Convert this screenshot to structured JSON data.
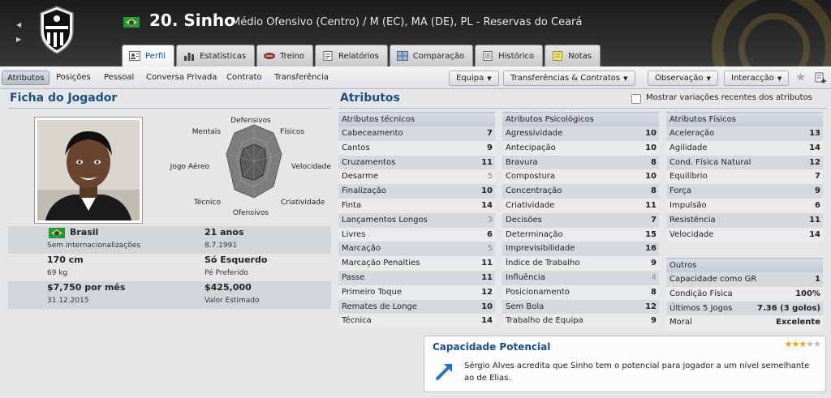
{
  "header": {
    "squad_number_name": "20. Sinho",
    "position_text": "Médio Ofensivo (Centro) / M (EC), MA (DE), PL - Reservas do Ceará",
    "club_crest_text": "CEARÁ"
  },
  "main_tabs": [
    {
      "label": "Perfil",
      "icon": "profile-icon"
    },
    {
      "label": "Estatísticas",
      "icon": "stats-icon"
    },
    {
      "label": "Treino",
      "icon": "training-icon"
    },
    {
      "label": "Relatórios",
      "icon": "report-icon"
    },
    {
      "label": "Comparação",
      "icon": "compare-icon"
    },
    {
      "label": "Histórico",
      "icon": "history-icon"
    },
    {
      "label": "Notas",
      "icon": "notes-icon"
    }
  ],
  "sub_nav": [
    "Atributos",
    "Posições",
    "Pessoal",
    "Conversa Privada",
    "Contrato",
    "Transferência"
  ],
  "dropdowns": [
    "Equipa",
    "Transferências & Contratos",
    "Observação",
    "Interacção"
  ],
  "player_card": {
    "title": "Ficha do Jogador",
    "nationality": "Brasil",
    "caps": "Sem internacionalizações",
    "age": "21 anos",
    "birth_date": "8.7.1991",
    "height": "170 cm",
    "weight": "69 kg",
    "foot": "Só Esquerdo",
    "foot_label": "Pé Preferido",
    "wage": "$7,750 por mês",
    "contract_end": "31.12.2015",
    "value": "$425,000",
    "value_label": "Valor Estimado"
  },
  "radar": {
    "labels": {
      "top": "Defensivos",
      "top_right": "Físicos",
      "right": "Velocidade",
      "bottom_right": "Criatividade",
      "bottom": "Ofensivos",
      "bottom_left": "Técnico",
      "left": "Jogo Aéreo",
      "top_left": "Mentais"
    }
  },
  "attributes": {
    "title": "Atributos",
    "show_changes_label": "Mostrar variações recentes dos atributos",
    "technical": {
      "header": "Atributos técnicos",
      "rows": [
        {
          "name": "Cabeceamento",
          "value": "7"
        },
        {
          "name": "Cantos",
          "value": "9"
        },
        {
          "name": "Cruzamentos",
          "value": "11"
        },
        {
          "name": "Desarme",
          "value": "5"
        },
        {
          "name": "Finalização",
          "value": "10"
        },
        {
          "name": "Finta",
          "value": "14"
        },
        {
          "name": "Lançamentos Longos",
          "value": "3"
        },
        {
          "name": "Livres",
          "value": "6"
        },
        {
          "name": "Marcação",
          "value": "5"
        },
        {
          "name": "Marcação Penalties",
          "value": "11"
        },
        {
          "name": "Passe",
          "value": "11"
        },
        {
          "name": "Primeiro Toque",
          "value": "12"
        },
        {
          "name": "Remates de Longe",
          "value": "10"
        },
        {
          "name": "Técnica",
          "value": "14"
        }
      ]
    },
    "mental": {
      "header": "Atributos Psicológicos",
      "rows": [
        {
          "name": "Agressividade",
          "value": "10"
        },
        {
          "name": "Antecipação",
          "value": "10"
        },
        {
          "name": "Bravura",
          "value": "8"
        },
        {
          "name": "Compostura",
          "value": "10"
        },
        {
          "name": "Concentração",
          "value": "8"
        },
        {
          "name": "Criatividade",
          "value": "11"
        },
        {
          "name": "Decisões",
          "value": "7"
        },
        {
          "name": "Determinação",
          "value": "15"
        },
        {
          "name": "Imprevisibilidade",
          "value": "16"
        },
        {
          "name": "Índice de Trabalho",
          "value": "9"
        },
        {
          "name": "Influência",
          "value": "4"
        },
        {
          "name": "Posicionamento",
          "value": "8"
        },
        {
          "name": "Sem Bola",
          "value": "12"
        },
        {
          "name": "Trabalho de Equipa",
          "value": "9"
        }
      ]
    },
    "physical": {
      "header": "Atributos Físicos",
      "rows": [
        {
          "name": "Aceleração",
          "value": "13"
        },
        {
          "name": "Agilidade",
          "value": "14"
        },
        {
          "name": "Cond. Física Natural",
          "value": "12"
        },
        {
          "name": "Equilíbrio",
          "value": "7"
        },
        {
          "name": "Força",
          "value": "9"
        },
        {
          "name": "Impulsão",
          "value": "6"
        },
        {
          "name": "Resistência",
          "value": "11"
        },
        {
          "name": "Velocidade",
          "value": "14"
        }
      ]
    },
    "other": {
      "header": "Outros",
      "rows": [
        {
          "name": "Capacidade como GR",
          "value": "1"
        },
        {
          "name": "Condição Física",
          "value": "100%"
        },
        {
          "name": "Últimos 5 Jogos",
          "value": "7.36 (3 golos)"
        },
        {
          "name": "Moral",
          "value": "Excelente"
        }
      ]
    }
  },
  "potential": {
    "title": "Capacidade Potencial",
    "stars": 3,
    "max_stars": 5,
    "text": "Sérgio Alves acredita que Sinho tem o potencial para jogador a um nível semelhante ao de Elias."
  }
}
